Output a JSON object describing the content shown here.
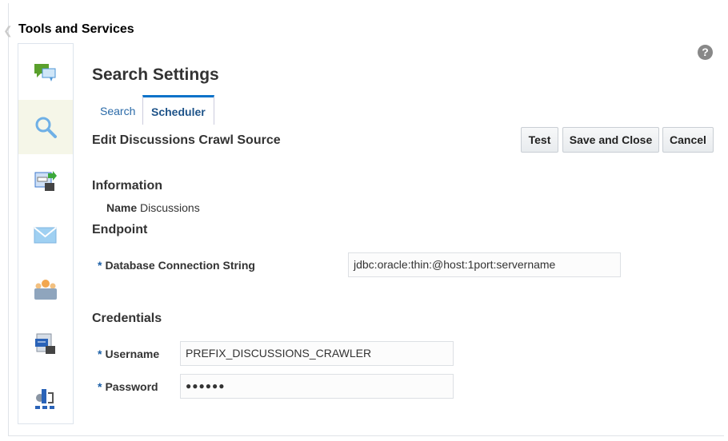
{
  "header": {
    "title": "Tools and Services",
    "help": "?"
  },
  "sidebar": {
    "items": [
      {
        "name": "discussions"
      },
      {
        "name": "search",
        "active": true
      },
      {
        "name": "content-server"
      },
      {
        "name": "mail"
      },
      {
        "name": "people"
      },
      {
        "name": "portal"
      },
      {
        "name": "process"
      }
    ]
  },
  "page": {
    "title": "Search Settings",
    "tabs": [
      {
        "label": "Search"
      },
      {
        "label": "Scheduler",
        "selected": true
      }
    ],
    "subtitle": "Edit Discussions Crawl Source",
    "buttons": {
      "test": "Test",
      "save": "Save and Close",
      "cancel": "Cancel"
    }
  },
  "information": {
    "heading": "Information",
    "name_label": "Name",
    "name_value": "Discussions"
  },
  "endpoint": {
    "heading": "Endpoint",
    "conn_label": "Database Connection String",
    "conn_value": "jdbc:oracle:thin:@host:1port:servername"
  },
  "credentials": {
    "heading": "Credentials",
    "username_label": "Username",
    "username_value": "PREFIX_DISCUSSIONS_CRAWLER",
    "password_label": "Password",
    "password_value": "●●●●●●"
  },
  "required_mark": "*"
}
